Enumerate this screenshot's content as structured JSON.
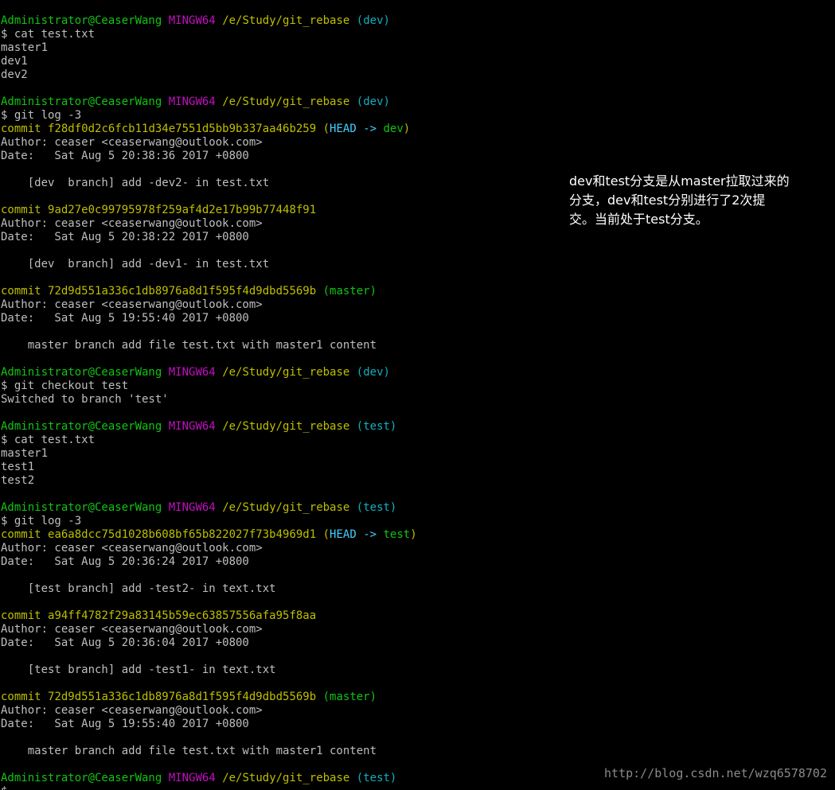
{
  "terminal": {
    "prompt_user": "Administrator@CeaserWang",
    "prompt_env": "MINGW64",
    "prompt_path": "/e/Study/git_rebase",
    "branch_dev": "(dev)",
    "branch_test": "(test)",
    "cmd_cat": "$ cat test.txt",
    "cmd_log": "$ git log -3",
    "cmd_checkout": "$ git checkout test",
    "cmd_partial": "$ ",
    "out_master1": "master1",
    "out_dev1": "dev1",
    "out_dev2": "dev2",
    "out_test1": "test1",
    "out_test2": "test2",
    "out_switched": "Switched to branch 'test'",
    "commit_word": "commit",
    "head_word": "HEAD",
    "arrow": "->",
    "dev_word": "dev",
    "test_word": "test",
    "master_label": "(master)",
    "paren_open": "(",
    "paren_close": ")",
    "author_line": "Author: ceaser <ceaserwang@outlook.com>",
    "commits_dev": [
      {
        "hash": "f28df0d2c6fcb11d34e7551d5bb9b337aa46b259",
        "date": "Date:   Sat Aug 5 20:38:36 2017 +0800",
        "message": "    [dev  branch] add -dev2- in test.txt"
      },
      {
        "hash": "9ad27e0c99795978f259af4d2e17b99b77448f91",
        "date": "Date:   Sat Aug 5 20:38:22 2017 +0800",
        "message": "    [dev  branch] add -dev1- in test.txt"
      },
      {
        "hash": "72d9d551a336c1db8976a8d1f595f4d9dbd5569b",
        "date": "Date:   Sat Aug 5 19:55:40 2017 +0800",
        "message": "    master branch add file test.txt with master1 content"
      }
    ],
    "commits_test": [
      {
        "hash": "ea6a8dcc75d1028b608bf65b822027f73b4969d1",
        "date": "Date:   Sat Aug 5 20:36:24 2017 +0800",
        "message": "    [test branch] add -test2- in text.txt"
      },
      {
        "hash": "a94ff4782f29a83145b59ec63857556afa95f8aa",
        "date": "Date:   Sat Aug 5 20:36:04 2017 +0800",
        "message": "    [test branch] add -test1- in text.txt"
      },
      {
        "hash": "72d9d551a336c1db8976a8d1f595f4d9dbd5569b",
        "date": "Date:   Sat Aug 5 19:55:40 2017 +0800",
        "message": "    master branch add file test.txt with master1 content"
      }
    ]
  },
  "annotation": {
    "line1": "dev和test分支是从master拉取过来的",
    "line2": "分支，dev和test分别进行了2次提",
    "line3": "交。当前处于test分支。"
  },
  "watermark": "http://blog.csdn.net/wzq6578702"
}
